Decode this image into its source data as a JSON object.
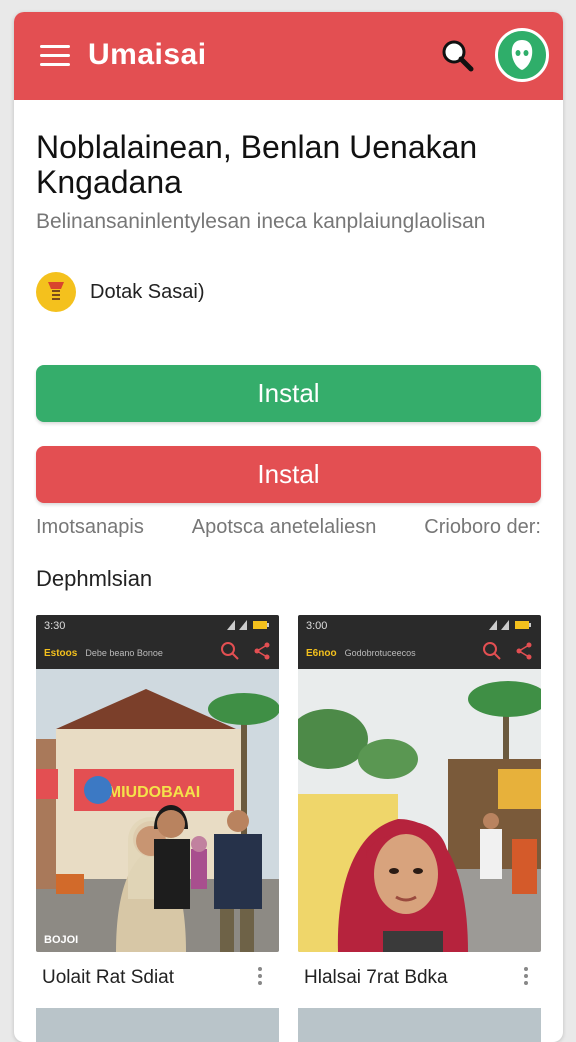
{
  "appbar": {
    "title": "Umaisai",
    "menu_icon": "menu-icon",
    "search_icon": "search-icon",
    "avatar_icon": "avatar-icon",
    "color": "#e34f52"
  },
  "app": {
    "headline": "Noblalainean, Benlan Uenakan Kngadana",
    "description": "Belinansaninlentylesan ineca kanplaiunglaolisan",
    "developer": "Dotak Sasai)"
  },
  "buttons": {
    "primary_label": "Instal",
    "secondary_label": "Instal",
    "primary_color": "#35ad6b",
    "secondary_color": "#e34f52"
  },
  "meta": {
    "items": [
      "Imotsanapis",
      "Apotsca anetelaliesn",
      "Crioboro der:"
    ]
  },
  "screenshots": {
    "section_title": "Dephmlsian",
    "items": [
      {
        "time": "3:30",
        "tag": "Estoos",
        "mini_title": "Debe beano Bonoe",
        "banner": "MIUDOBAAI",
        "footer": "BOJOI",
        "caption": "Uolait Rat Sdiat"
      },
      {
        "time": "3:00",
        "tag": "E6noo",
        "mini_title": "Godobrotuceecos",
        "footer": "",
        "caption": "Hlalsai 7rat Bdka"
      }
    ]
  }
}
